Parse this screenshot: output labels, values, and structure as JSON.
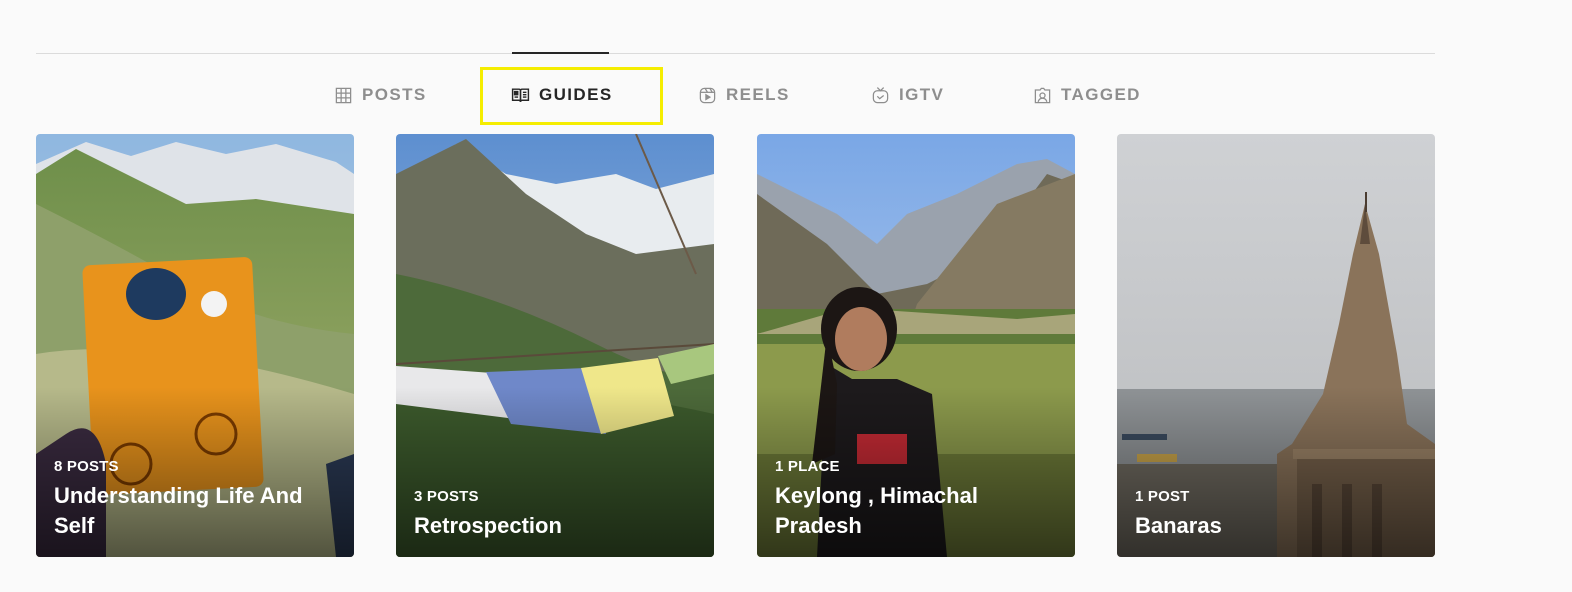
{
  "tabs": [
    {
      "label": "POSTS",
      "icon": "grid-icon",
      "active": false
    },
    {
      "label": "GUIDES",
      "icon": "guide-book-icon",
      "active": true
    },
    {
      "label": "REELS",
      "icon": "reels-icon",
      "active": false
    },
    {
      "label": "IGTV",
      "icon": "igtv-icon",
      "active": false
    },
    {
      "label": "TAGGED",
      "icon": "tagged-icon",
      "active": false
    }
  ],
  "highlight_color": "#f5ed00",
  "guides": [
    {
      "count": "8 POSTS",
      "title": "Understanding Life And Self"
    },
    {
      "count": "3 POSTS",
      "title": "Retrospection"
    },
    {
      "count": "1 PLACE",
      "title": "Keylong , Himachal Pradesh"
    },
    {
      "count": "1 POST",
      "title": "Banaras"
    }
  ]
}
